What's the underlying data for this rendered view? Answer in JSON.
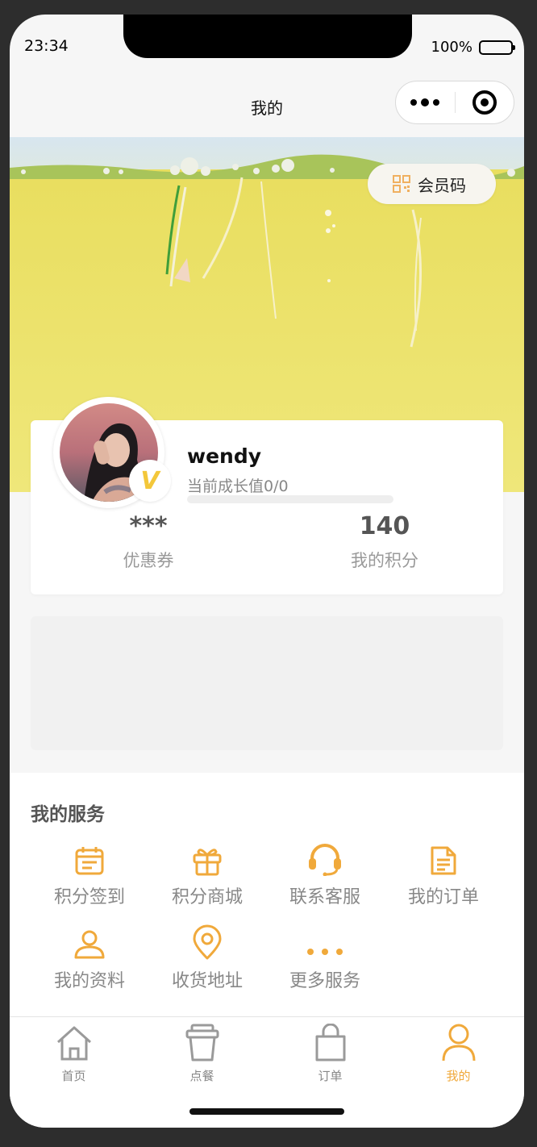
{
  "status_bar": {
    "time": "23:34",
    "battery": "100%"
  },
  "nav": {
    "title": "我的"
  },
  "member_code": {
    "label": "会员码"
  },
  "profile": {
    "username": "wendy",
    "growth_text": "当前成长值0/0",
    "growth_progress": 0,
    "vip_badge": "V"
  },
  "stats": {
    "coupons": {
      "value": "***",
      "label": "优惠券"
    },
    "points": {
      "value": "140",
      "label": "我的积分"
    }
  },
  "services": {
    "title": "我的服务",
    "items": [
      {
        "label": "积分签到",
        "icon": "calendar-icon"
      },
      {
        "label": "积分商城",
        "icon": "gift-icon"
      },
      {
        "label": "联系客服",
        "icon": "headset-icon"
      },
      {
        "label": "我的订单",
        "icon": "document-icon"
      },
      {
        "label": "我的资料",
        "icon": "user-icon"
      },
      {
        "label": "收货地址",
        "icon": "location-pin-icon"
      },
      {
        "label": "更多服务",
        "icon": "more-dots-icon"
      }
    ]
  },
  "tabbar": {
    "items": [
      {
        "label": "首页",
        "icon": "home-icon",
        "active": false
      },
      {
        "label": "点餐",
        "icon": "cup-icon",
        "active": false
      },
      {
        "label": "订单",
        "icon": "bag-icon",
        "active": false
      },
      {
        "label": "我的",
        "icon": "person-icon",
        "active": true
      }
    ]
  },
  "colors": {
    "accent": "#f0a93b",
    "banner_yellow": "#ece36e",
    "badge_yellow": "#f3c73a"
  }
}
